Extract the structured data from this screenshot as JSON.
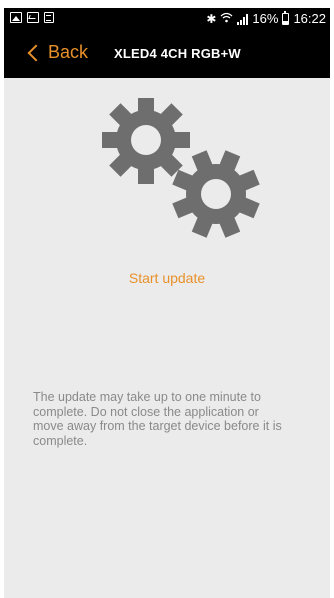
{
  "status_bar": {
    "battery": "16%",
    "time": "16:22",
    "icons": [
      "image-icon",
      "chart-icon",
      "clipboard-icon",
      "bluetooth-icon",
      "wifi-icon",
      "signal-icon",
      "battery-icon"
    ]
  },
  "navbar": {
    "back_label": "Back",
    "title": "XLED4 4CH RGB+W"
  },
  "main": {
    "illustration": "gears-icon",
    "start_update_label": "Start update",
    "info_text": "The update may take up to one minute to complete. Do not close the application or move away from the target device before it is complete."
  },
  "colors": {
    "accent": "#e8912a",
    "background": "#ebebeb",
    "bar": "#000000",
    "gear": "#6e6e6e",
    "info_text": "#8a8a8a"
  }
}
